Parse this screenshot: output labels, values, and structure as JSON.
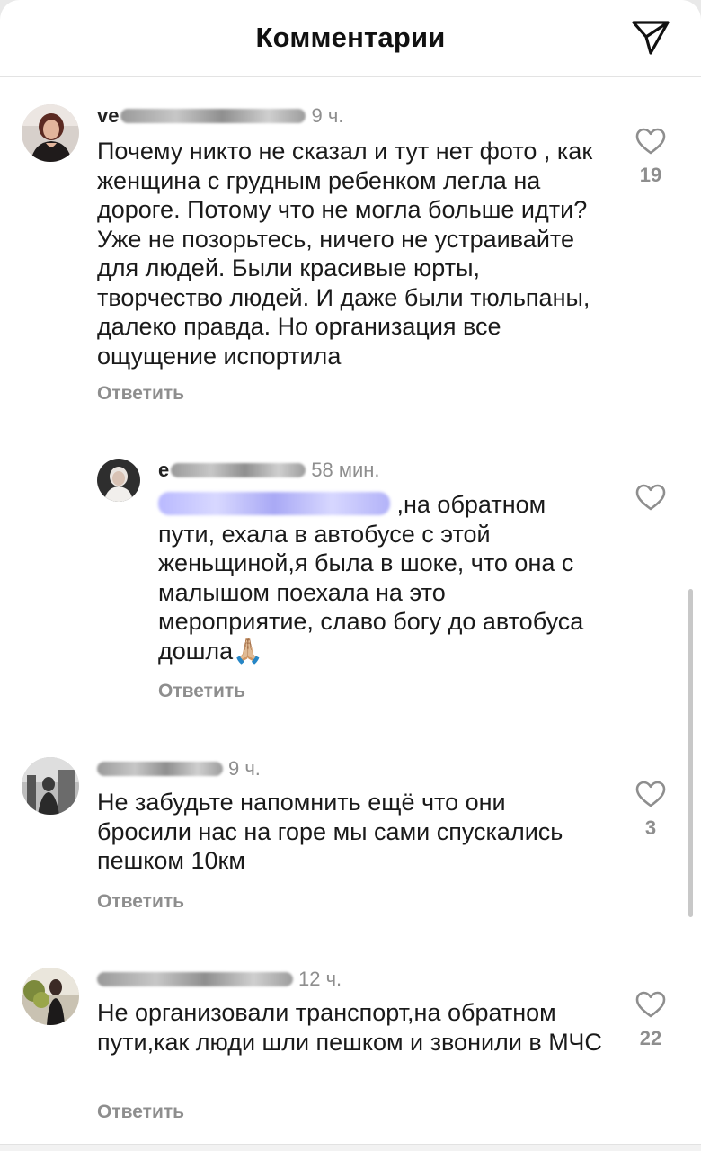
{
  "header": {
    "title": "Комментарии",
    "share_icon": "send-icon"
  },
  "comments": [
    {
      "username_visible": "ve",
      "time": "9 ч.",
      "text": "Почему никто не сказал и тут нет фото , как женщина с грудным ребенком легла на дороге. Потому что не могла больше идти? Уже не позорьтесь, ничего не устраивайте для людей. Были красивые юрты, творчество людей. И даже были тюльпаны, далеко правда. Но организация все  ощущение испортила",
      "reply_label": "Ответить",
      "likes": "19"
    },
    {
      "username_visible": "e",
      "time": "58 мин.",
      "text": " ,на обратном пути, ехала в автобусе с этой женьщиной,я была в шоке, что она с малышом поехала на это мероприятие,  славо богу до автобуса дошла",
      "emoji": "🙏🏼",
      "reply_label": "Ответить",
      "likes": ""
    },
    {
      "username_visible": "",
      "time": "9 ч.",
      "text": "Не забудьте напомнить ещё что они бросили нас на горе мы сами спускались пешком 10км",
      "reply_label": "Ответить",
      "likes": "3"
    },
    {
      "username_visible": "",
      "time": "12 ч.",
      "text": "Не организовали транспорт,на обратном пути,как люди шли пешком и звонили в МЧС",
      "reply_label": "Ответить",
      "likes": "22"
    }
  ]
}
